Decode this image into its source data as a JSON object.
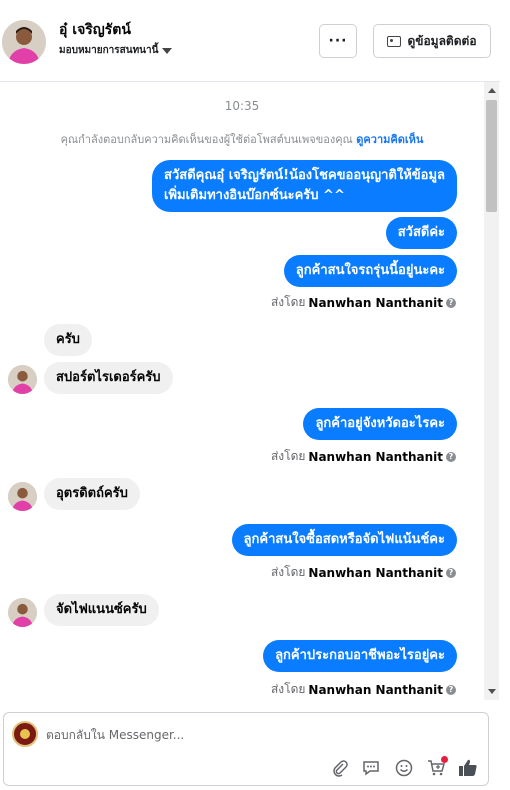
{
  "header": {
    "name": "อุ๋ เจริญรัตน์",
    "assign_label": "มอบหมายการสนทนานี้",
    "more_label": "···",
    "contact_button": "ดูข้อมูลติดต่อ"
  },
  "chat": {
    "time": "10:35",
    "notice_text": "คุณกำลังตอบกลับความคิดเห็นของผู้ใช้ต่อโพสต์บนเพจของคุณ",
    "notice_link": "ดูความคิดเห็น",
    "sent_by_prefix": "ส่งโดย",
    "sender": "Nanwhan Nanthanit",
    "messages": [
      {
        "dir": "out",
        "lines": [
          "สวัสดีคุณอุ๋ เจริญรัตน์!น้องโชคขออนุญาติให้ข้อมูล",
          "เพิ่มเติมทางอินบ๊อกซ์นะครับ ^^"
        ]
      },
      {
        "dir": "out",
        "lines": [
          "สวัสดีค่ะ"
        ]
      },
      {
        "dir": "out",
        "lines": [
          "ลูกค้าสนใจรถรุ่นนี้อยู่นะคะ"
        ]
      },
      {
        "dir": "in",
        "lines": [
          "ครับ"
        ]
      },
      {
        "dir": "in",
        "lines": [
          "สปอร์ตไรเดอร์ครับ"
        ]
      },
      {
        "dir": "out",
        "lines": [
          "ลูกค้าอยู่จังหวัดอะไรคะ"
        ]
      },
      {
        "dir": "in",
        "lines": [
          "อุตรดิตถ์ครับ"
        ]
      },
      {
        "dir": "out",
        "lines": [
          "ลูกค้าสนใจซื้อสดหรือจัดไฟแน้นช์คะ"
        ]
      },
      {
        "dir": "in",
        "lines": [
          "จัดไฟแนนซ์ครับ"
        ]
      },
      {
        "dir": "out",
        "lines": [
          "ลูกค้าประกอบอาชีพอะไรอยู่คะ"
        ]
      }
    ]
  },
  "composer": {
    "placeholder": "ตอบกลับใน Messenger..."
  },
  "colors": {
    "outgoing_bubble": "#0a7cff",
    "incoming_bubble": "#f0f0f0",
    "link": "#1877f2",
    "badge": "#e41e3f"
  },
  "icons": [
    "chevron-down-icon",
    "contact-card-icon",
    "attachment-icon",
    "saved-reply-icon",
    "emoji-icon",
    "cart-icon",
    "thumbs-up-icon"
  ]
}
